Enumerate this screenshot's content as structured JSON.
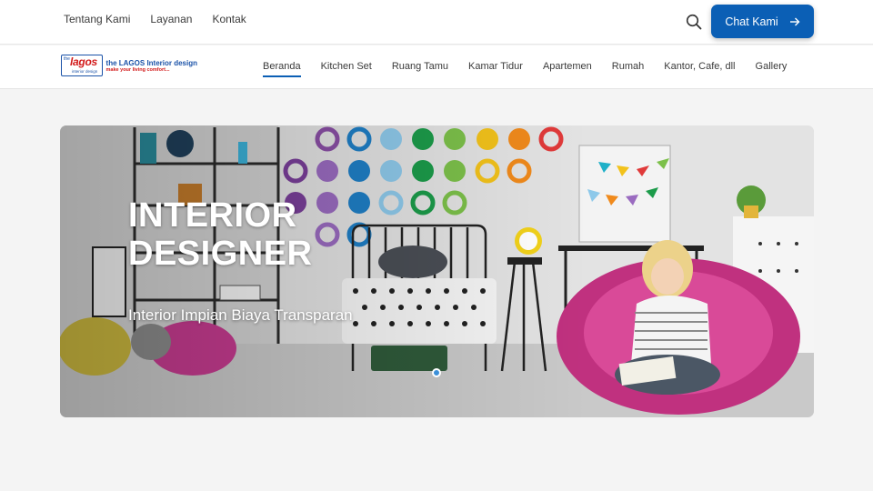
{
  "topbar": {
    "links": [
      "Tentang Kami",
      "Layanan",
      "Kontak"
    ],
    "search_icon": "search-icon",
    "chat_label": "Chat Kami",
    "chat_icon": "arrow-right-icon"
  },
  "logo": {
    "badge_small": "the",
    "badge_word": "lagos",
    "badge_sub": "interior design",
    "title": "the LAGOS Interior design",
    "tagline": "make your living comfort..."
  },
  "nav": {
    "items": [
      "Beranda",
      "Kitchen Set",
      "Ruang Tamu",
      "Kamar Tidur",
      "Apartemen",
      "Rumah",
      "Kantor, Cafe, dll",
      "Gallery"
    ],
    "active_index": 0
  },
  "hero": {
    "title_line1": "INTERIOR",
    "title_line2": "DESIGNER",
    "subtitle": "Interior Impian Biaya Transparan",
    "slide_count": 1,
    "active_slide": 0
  },
  "colors": {
    "accent": "#0b5fb5",
    "logo_red": "#d21a1a",
    "logo_blue": "#1a52a8"
  }
}
